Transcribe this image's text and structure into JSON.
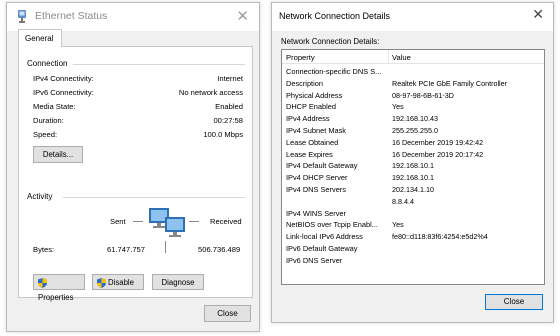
{
  "ethernet_status": {
    "title": "Ethernet Status",
    "tab": "General",
    "connection": {
      "heading": "Connection",
      "rows": [
        {
          "label": "IPv4 Connectivity:",
          "value": "Internet"
        },
        {
          "label": "IPv6 Connectivity:",
          "value": "No network access"
        },
        {
          "label": "Media State:",
          "value": "Enabled"
        },
        {
          "label": "Duration:",
          "value": "00:27:58"
        },
        {
          "label": "Speed:",
          "value": "100.0 Mbps"
        }
      ],
      "details_button": "Details..."
    },
    "activity": {
      "heading": "Activity",
      "sent_label": "Sent",
      "received_label": "Received",
      "bytes_label": "Bytes:",
      "bytes_sent": "61.747.757",
      "bytes_received": "506.736.489"
    },
    "buttons": {
      "properties": "Properties",
      "disable": "Disable",
      "diagnose": "Diagnose",
      "close": "Close"
    }
  },
  "connection_details": {
    "title": "Network Connection Details",
    "heading": "Network Connection Details:",
    "columns": [
      "Property",
      "Value"
    ],
    "rows": [
      {
        "property": "Connection-specific DNS S...",
        "value": ""
      },
      {
        "property": "Description",
        "value": "Realtek PCIe GbE Family Controller"
      },
      {
        "property": "Physical Address",
        "value": "08-97-98-6B-61-3D"
      },
      {
        "property": "DHCP Enabled",
        "value": "Yes"
      },
      {
        "property": "IPv4 Address",
        "value": "192.168.10.43"
      },
      {
        "property": "IPv4 Subnet Mask",
        "value": "255.255.255.0"
      },
      {
        "property": "Lease Obtained",
        "value": "16 December 2019 19:42:42"
      },
      {
        "property": "Lease Expires",
        "value": "16 December 2019 20:17:42"
      },
      {
        "property": "IPv4 Default Gateway",
        "value": "192.168.10.1"
      },
      {
        "property": "IPv4 DHCP Server",
        "value": "192.168.10.1"
      },
      {
        "property": "IPv4 DNS Servers",
        "value": "202.134.1.10"
      },
      {
        "property": "",
        "value": "8.8.4.4"
      },
      {
        "property": "IPv4 WINS Server",
        "value": ""
      },
      {
        "property": "NetBIOS over Tcpip Enabl...",
        "value": "Yes"
      },
      {
        "property": "Link-local IPv6 Address",
        "value": "fe80::d118:83f6:4254:e5d2%4"
      },
      {
        "property": "IPv6 Default Gateway",
        "value": ""
      },
      {
        "property": "IPv6 DNS Server",
        "value": ""
      }
    ],
    "close_button": "Close"
  }
}
